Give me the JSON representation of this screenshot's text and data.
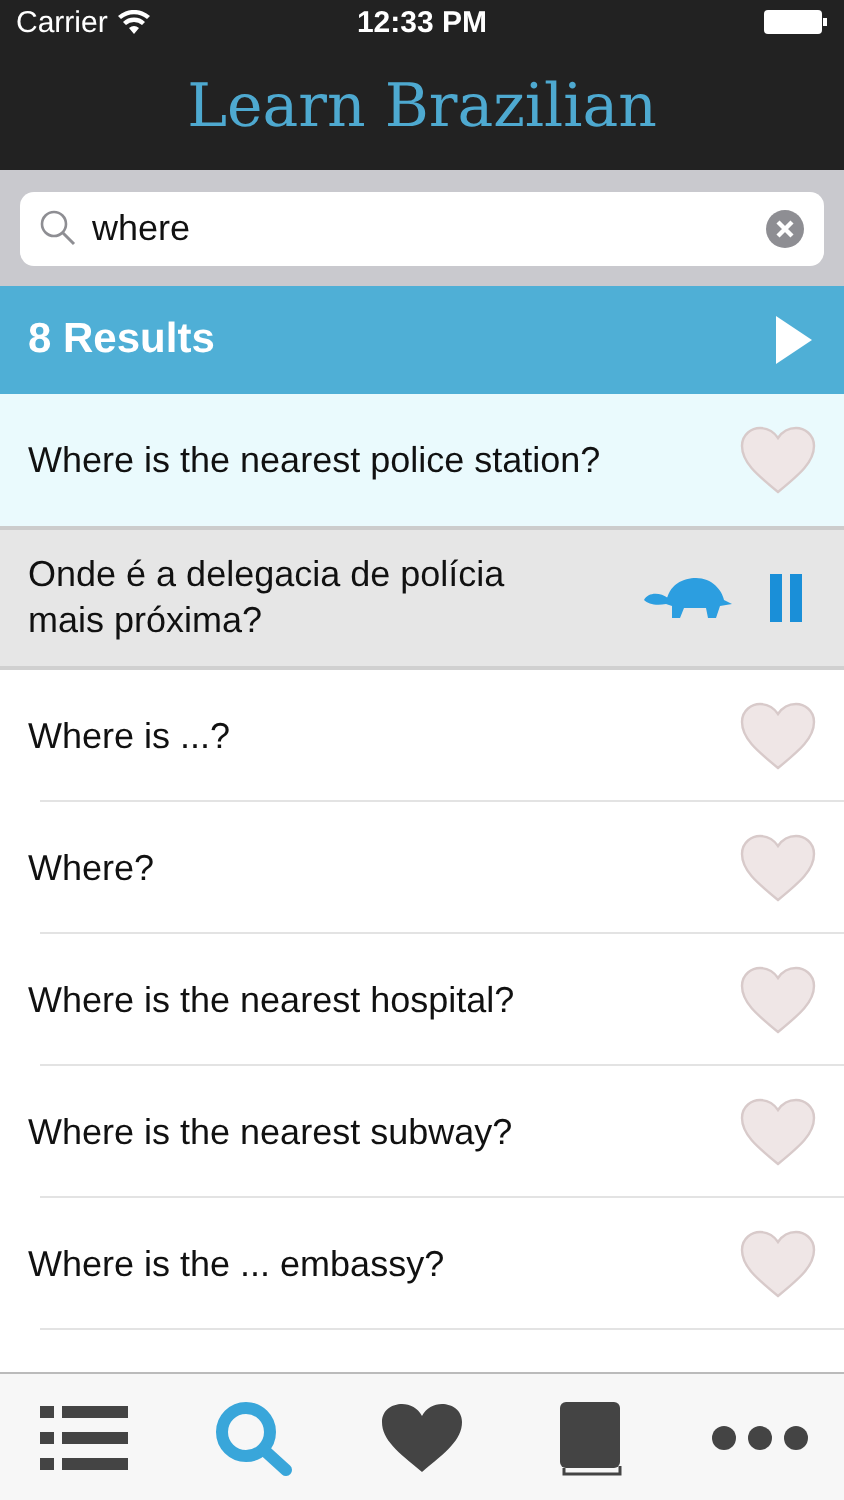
{
  "status_bar": {
    "carrier": "Carrier",
    "time": "12:33 PM"
  },
  "title": "Learn Brazilian",
  "search": {
    "value": "where"
  },
  "results": {
    "count": "8 Results"
  },
  "rows": [
    {
      "text": "Where is the nearest police station?",
      "selected": true,
      "favorite": false,
      "translation": "Onde é a delegacia de polícia mais próxima?",
      "playing": true
    },
    {
      "text": "Where is ...?",
      "selected": false,
      "favorite": false
    },
    {
      "text": "Where?",
      "selected": false,
      "favorite": false
    },
    {
      "text": "Where is the nearest hospital?",
      "selected": false,
      "favorite": false
    },
    {
      "text": "Where is the nearest subway?",
      "selected": false,
      "favorite": false
    },
    {
      "text": "Where is the ... embassy?",
      "selected": false,
      "favorite": false
    }
  ],
  "tabs": [
    {
      "kind": "list",
      "selected": false
    },
    {
      "kind": "search",
      "selected": true
    },
    {
      "kind": "heart",
      "selected": false
    },
    {
      "kind": "book",
      "selected": false
    },
    {
      "kind": "more",
      "selected": false
    }
  ]
}
